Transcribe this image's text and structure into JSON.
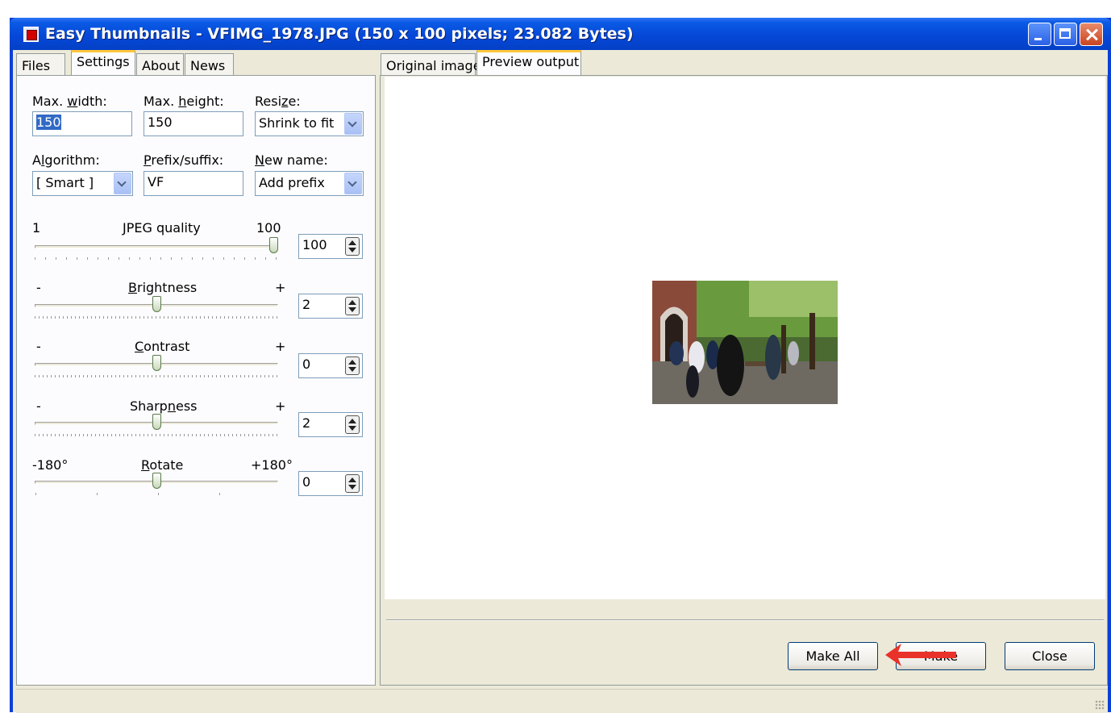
{
  "window": {
    "title": "Easy Thumbnails - VFIMG_1978.JPG  (150 x 100 pixels;  23.082 Bytes)"
  },
  "left_tabs": [
    "Files",
    "Settings",
    "About",
    "News"
  ],
  "left_tabs_active": "Settings",
  "right_tabs": [
    "Original image",
    "Preview output"
  ],
  "right_tabs_active": "Preview output",
  "settings": {
    "max_width": {
      "label_pre": "Max. ",
      "label_key": "w",
      "label_post": "idth:",
      "value": "150"
    },
    "max_height": {
      "label_pre": "Max. ",
      "label_key": "h",
      "label_post": "eight:",
      "value": "150"
    },
    "resize": {
      "label_pre": "Resi",
      "label_key": "z",
      "label_post": "e:",
      "value": "Shrink to fit"
    },
    "algorithm": {
      "label_pre": "A",
      "label_key": "l",
      "label_post": "gorithm:",
      "value": "[ Smart ]"
    },
    "prefix_suffix": {
      "label_key": "P",
      "label_post": "refix/suffix:",
      "value": "VF"
    },
    "new_name": {
      "label_key": "N",
      "label_post": "ew name:",
      "value": "Add prefix"
    }
  },
  "sliders": {
    "jpeg": {
      "min_label": "1",
      "label_key": "J",
      "label_post": "PEG quality",
      "max_label": "100",
      "value": "100",
      "level": 1.0
    },
    "brightness": {
      "min_label": "-",
      "label_key": "B",
      "label_post": "rightness",
      "max_label": "+",
      "value": "2",
      "level": 0.5
    },
    "contrast": {
      "min_label": "-",
      "label_key": "C",
      "label_post": "ontrast",
      "max_label": "+",
      "value": "0",
      "level": 0.5
    },
    "sharpness": {
      "min_label": "-",
      "label_pre": "Sharp",
      "label_key": "n",
      "label_post": "ess",
      "max_label": "+",
      "value": "2",
      "level": 0.5
    },
    "rotate": {
      "min_label": "-180°",
      "label_key": "R",
      "label_post": "otate",
      "max_label": "+180°",
      "value": "0",
      "level": 0.5
    }
  },
  "buttons": {
    "make_all": "Make All",
    "make": "Make",
    "close": "Close"
  },
  "colors": {
    "titlebar": "#0548d8",
    "tab_highlight": "#ffc83c",
    "annotation_arrow": "#e8322a"
  }
}
